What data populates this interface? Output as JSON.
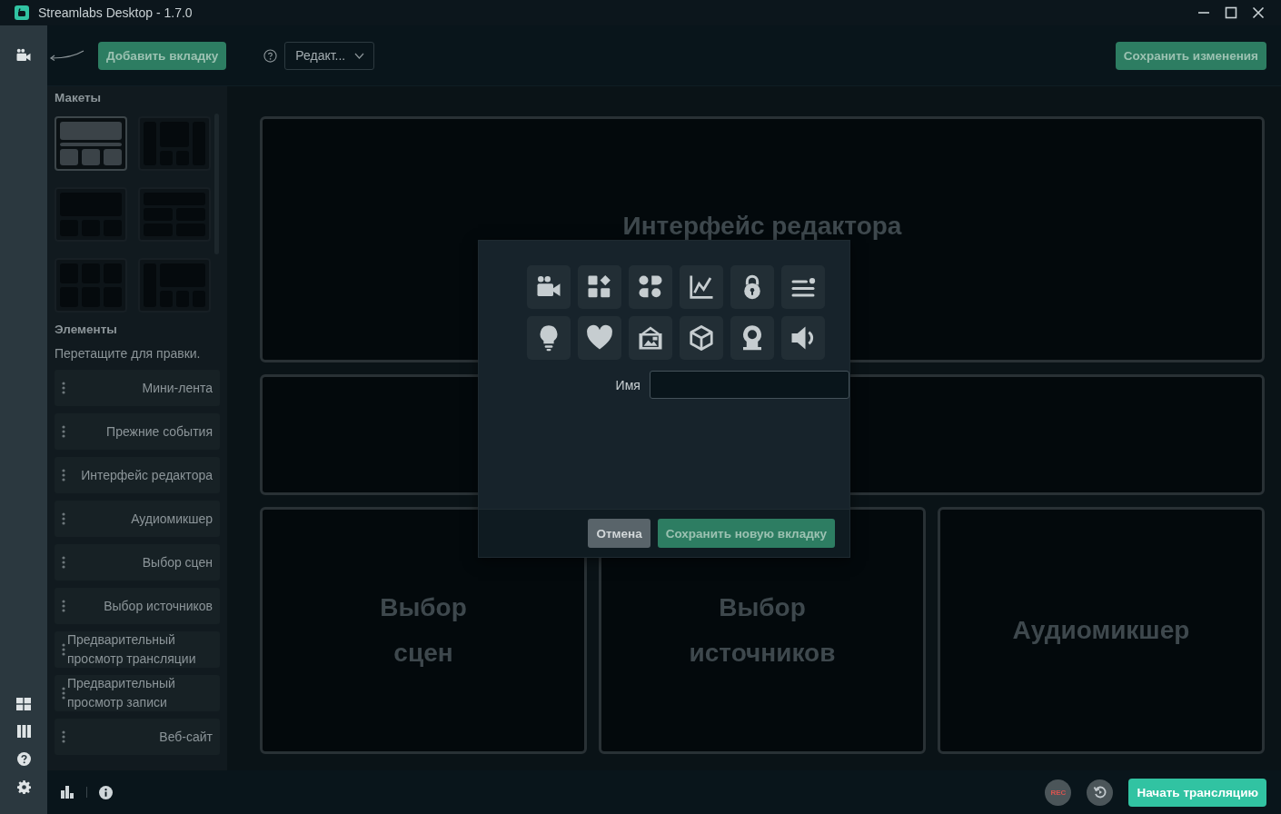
{
  "window": {
    "title": "Streamlabs Desktop - 1.7.0"
  },
  "toolbar": {
    "add_tab_button": "Добавить вкладку",
    "layout_dropdown": "Редакт...",
    "save_button": "Сохранить изменения"
  },
  "sidebar": {
    "layouts_heading": "Макеты",
    "layouts": [
      {
        "kind": "wide-top",
        "selected": true
      },
      {
        "kind": "three-column",
        "selected": false
      },
      {
        "kind": "top-three",
        "selected": false
      },
      {
        "kind": "rows",
        "selected": false
      },
      {
        "kind": "grid-six",
        "selected": false
      },
      {
        "kind": "side-left",
        "selected": false
      }
    ],
    "elements_heading": "Элементы",
    "elements_hint": "Перетащите для правки.",
    "elements": [
      "Мини-лента",
      "Прежние события",
      "Интерфейс редактора",
      "Аудиомикшер",
      "Выбор сцен",
      "Выбор источников",
      "Предварительный просмотр трансляции",
      "Предварительный просмотр записи",
      "Веб-сайт"
    ]
  },
  "canvas": {
    "rows": [
      {
        "slots": [
          {
            "kind": "slot",
            "label": "Интерфейс редактора"
          }
        ]
      },
      {
        "slots": [
          {
            "kind": "slot"
          }
        ]
      },
      {
        "slots": [
          {
            "kind": "slot",
            "label": "Выбор сцен"
          },
          {
            "kind": "slot",
            "label": "Выбор источников"
          },
          {
            "kind": "slot",
            "label": "Аудиомикшер"
          }
        ]
      }
    ]
  },
  "dialog": {
    "name_label": "Имя",
    "cancel_button": "Отмена",
    "confirm_button": "Сохранить новую вкладку"
  },
  "footer": {
    "rec_button": "REC",
    "start_button": "Начать трансляцию"
  }
}
